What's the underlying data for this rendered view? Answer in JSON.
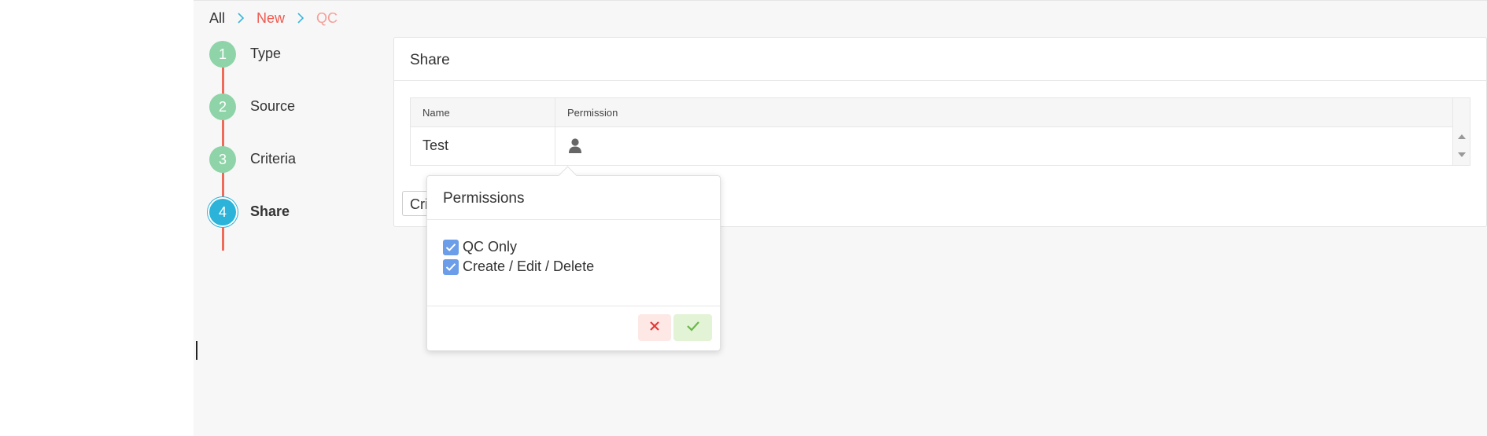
{
  "breadcrumb": {
    "items": [
      "All",
      "New",
      "QC"
    ]
  },
  "stepper": {
    "steps": [
      {
        "number": "1",
        "label": "Type"
      },
      {
        "number": "2",
        "label": "Source"
      },
      {
        "number": "3",
        "label": "Criteria"
      },
      {
        "number": "4",
        "label": "Share"
      }
    ],
    "active_step": 4
  },
  "share_panel": {
    "title": "Share",
    "table": {
      "columns": [
        "Name",
        "Permission"
      ],
      "rows": [
        {
          "name": "Test",
          "permission_icon": "user-icon"
        }
      ]
    },
    "criteria_button_label": "Criteria"
  },
  "permissions_popup": {
    "title": "Permissions",
    "options": [
      {
        "label": "QC Only",
        "checked": true
      },
      {
        "label": "Create / Edit / Delete",
        "checked": true
      }
    ],
    "cancel_icon": "close-icon",
    "confirm_icon": "check-icon"
  },
  "colors": {
    "accent_red": "#f05a4f",
    "step_done": "#8fd4a8",
    "step_active": "#2bb3d9",
    "checkbox": "#6b9de8"
  }
}
